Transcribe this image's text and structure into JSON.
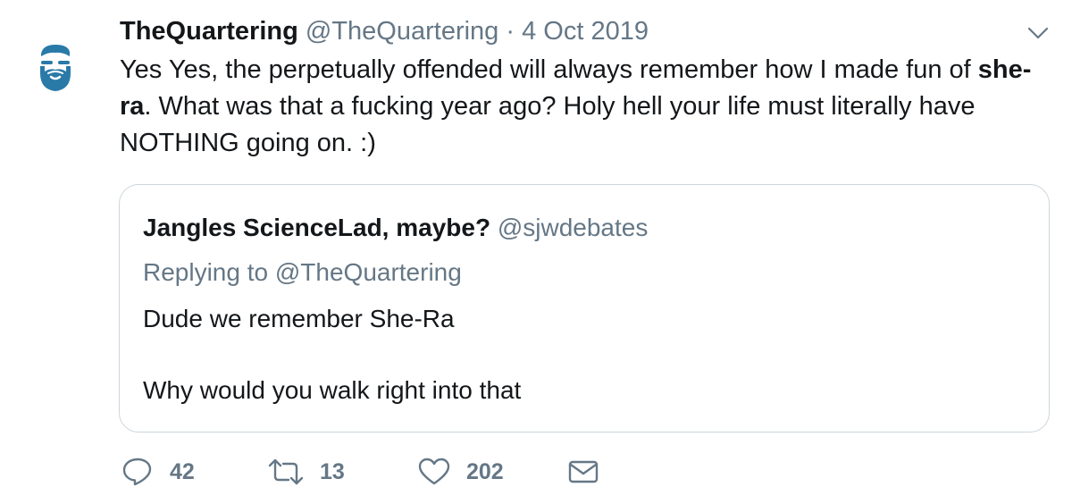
{
  "tweet": {
    "display_name": "TheQuartering",
    "handle": "@TheQuartering",
    "separator": "·",
    "date": "4 Oct 2019",
    "text_part1": "Yes Yes, the perpetually offended will always remember how I made fun of ",
    "text_bold1": "she-",
    "text_bold2": "ra",
    "text_part2": ".  What was that a fucking year ago?  Holy hell your life must literally have NOTHING going on. :)"
  },
  "quoted_tweet": {
    "display_name": "Jangles ScienceLad, maybe?",
    "handle": "@sjwdebates",
    "replying_to": "Replying to @TheQuartering",
    "line1": "Dude we remember She-Ra",
    "line2": "Why would you walk right into that"
  },
  "actions": {
    "reply_count": "42",
    "retweet_count": "13",
    "like_count": "202"
  },
  "icons": {
    "avatar": "bearded-man-avatar-icon",
    "menu": "chevron-down-icon",
    "reply": "reply-icon",
    "retweet": "retweet-icon",
    "like": "heart-icon",
    "message": "envelope-icon"
  },
  "colors": {
    "avatar": "#2a7aa8",
    "secondary_text": "#657786",
    "border": "#ccd6dd",
    "primary_text": "#14171a"
  }
}
